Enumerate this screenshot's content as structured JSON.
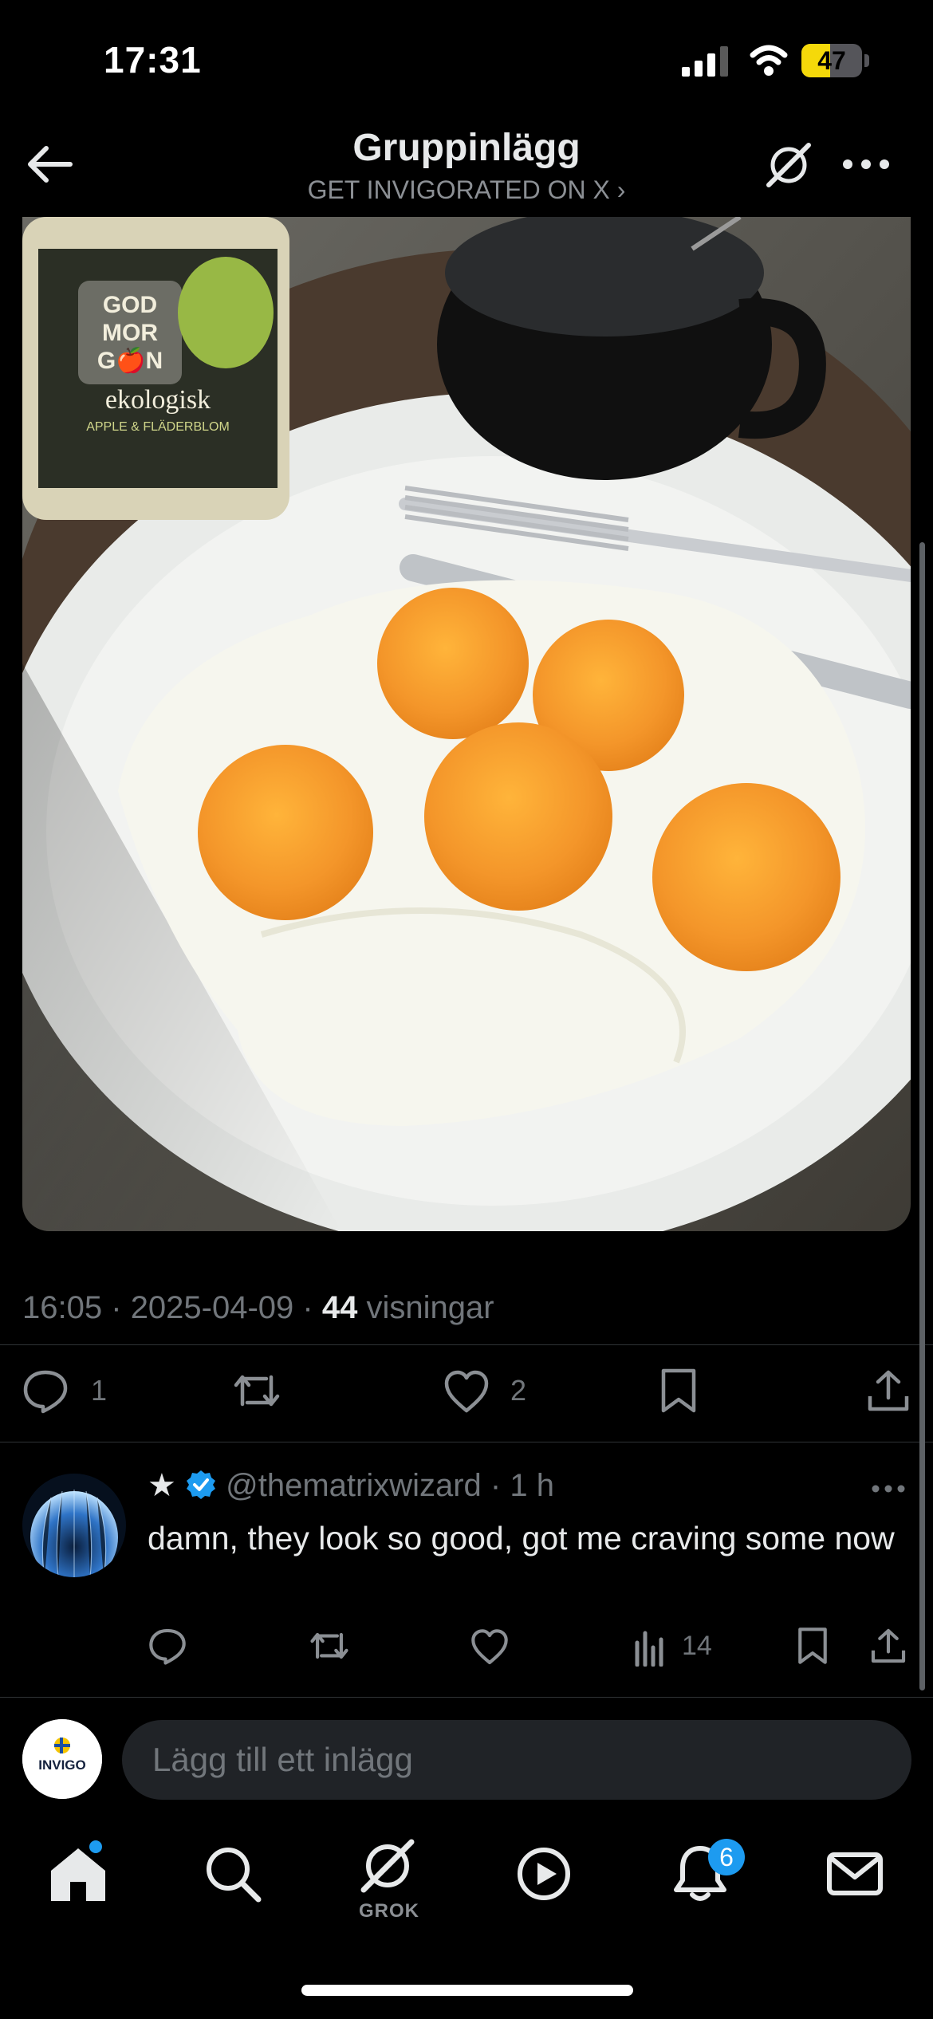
{
  "status_bar": {
    "time": "17:31",
    "battery_percent": "47",
    "battery_level": 0.47
  },
  "header": {
    "title": "Gruppinlägg",
    "subtitle": "GET INVIGORATED ON X ›"
  },
  "post": {
    "photo_icon": "photo-fried-eggs",
    "bottle_label": {
      "line1": "GOD",
      "line2": "MOR",
      "line3": "G🍎N",
      "line4": "ekologisk",
      "line5": "APPLE & FLÄDERBLOM"
    },
    "meta": {
      "time": "16:05",
      "date": "2025-04-09",
      "views_count": "44",
      "views_label": "visningar",
      "sep": "·"
    },
    "actions": {
      "replies": "1",
      "likes": "2"
    }
  },
  "reply": {
    "prefix_icon": "star-icon",
    "verified_icon": "verified-badge-icon",
    "handle": "@thematrixwizard",
    "age": "1 h",
    "sep": "·",
    "text": "damn, they look so good, got me craving some now",
    "views": "14"
  },
  "composer": {
    "placeholder": "Lägg till ett inlägg",
    "avatar_text": "INVIGO"
  },
  "tabbar": {
    "grok_label": "GROK",
    "notifications_badge": "6"
  },
  "colors": {
    "accent": "#1d9bf0",
    "background": "#000000",
    "muted": "#71767b",
    "text": "#e7e9ea"
  }
}
